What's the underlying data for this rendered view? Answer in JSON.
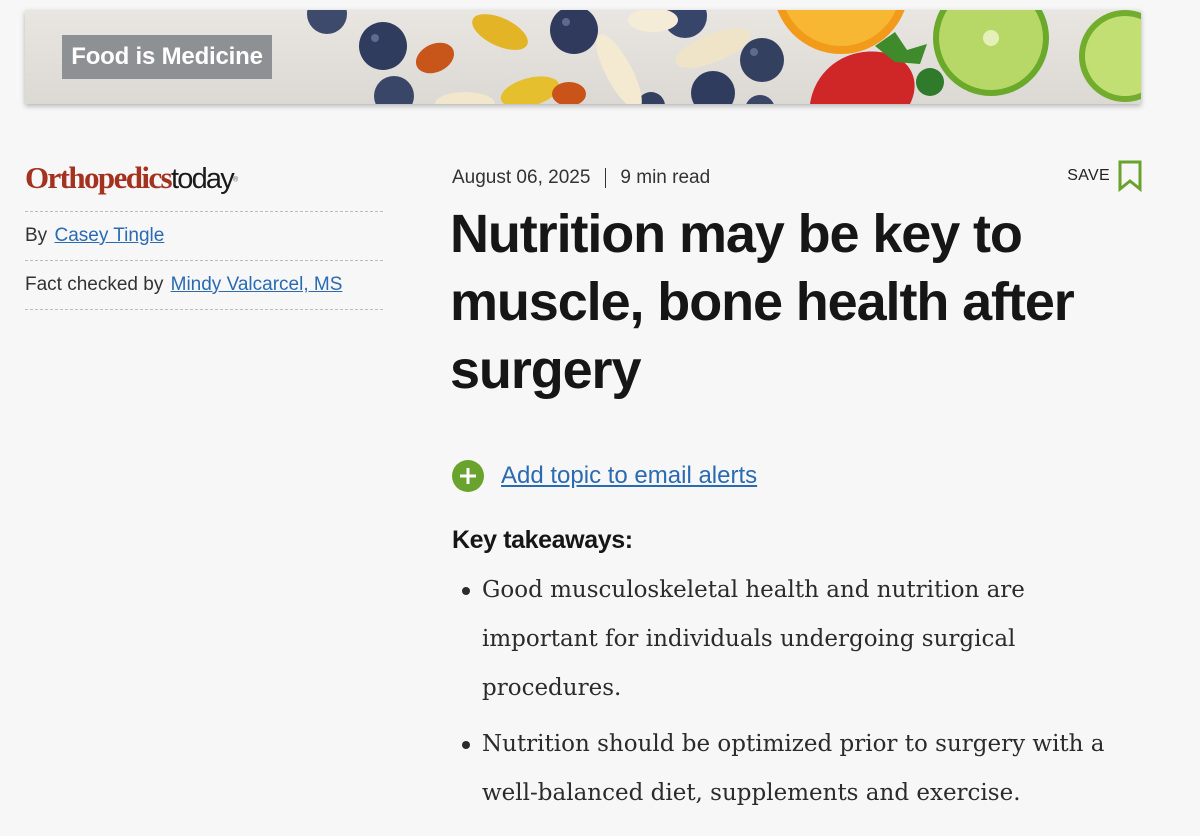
{
  "banner": {
    "label": "Food is Medicine"
  },
  "brand": {
    "name_bold": "Orthopedics",
    "name_light": "today",
    "trademark": "®"
  },
  "byline": {
    "prefix": "By",
    "author": "Casey Tingle"
  },
  "factcheck": {
    "prefix": "Fact checked by",
    "checker": "Mindy Valcarcel, MS"
  },
  "meta": {
    "date": "August 06, 2025",
    "read_time": "9 min read"
  },
  "save": {
    "label": "SAVE",
    "icon": "bookmark-icon"
  },
  "article": {
    "headline": "Nutrition may be key to muscle, bone health after surgery"
  },
  "alerts": {
    "label": "Add topic to email alerts",
    "icon": "plus-circle-icon"
  },
  "takeaways": {
    "title": "Key takeaways:",
    "items": [
      "Good musculoskeletal health and nutrition are important for individuals undergoing surgical procedures.",
      "Nutrition should be optimized prior to surgery with a well-balanced diet, supplements and exercise."
    ]
  },
  "colors": {
    "brand_red": "#a5311f",
    "link_blue": "#2a6ab3",
    "accent_green": "#6aa22e",
    "label_gray": "#8d9193",
    "background": "#f7f7f7"
  }
}
